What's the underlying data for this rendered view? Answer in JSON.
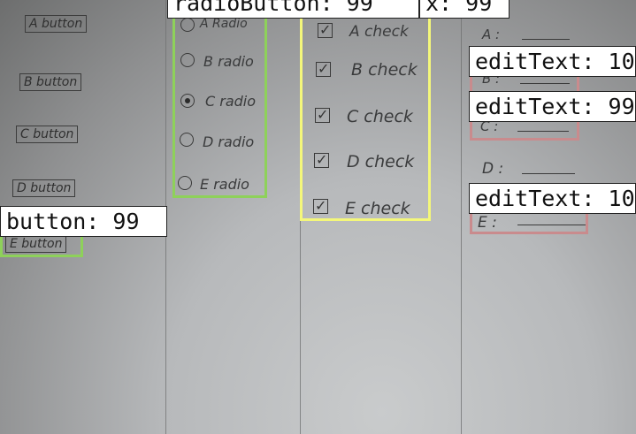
{
  "colors": {
    "button_box": "#8ed15a",
    "radio_box": "#8ed15a",
    "check_box": "#f4f77a",
    "edit_box": "#c98b8d"
  },
  "buttons": [
    "A button",
    "B button",
    "C button",
    "D button",
    "E button"
  ],
  "radios": [
    {
      "label": "A Radio",
      "selected": false
    },
    {
      "label": "B radio",
      "selected": false
    },
    {
      "label": "C radio",
      "selected": true
    },
    {
      "label": "D radio",
      "selected": false
    },
    {
      "label": "E radio",
      "selected": false
    }
  ],
  "checks": [
    "A check",
    "B check",
    "C check",
    "D check",
    "E check"
  ],
  "edits": [
    "A :",
    "B :",
    "C :",
    "D :",
    "E :"
  ],
  "detections": {
    "button": "button: 99",
    "radio": "radioButton: 99",
    "checkbox": "x: 99",
    "edit_a": "editText: 10",
    "edit_c": "editText: 99",
    "edit_e": "editText: 10"
  }
}
